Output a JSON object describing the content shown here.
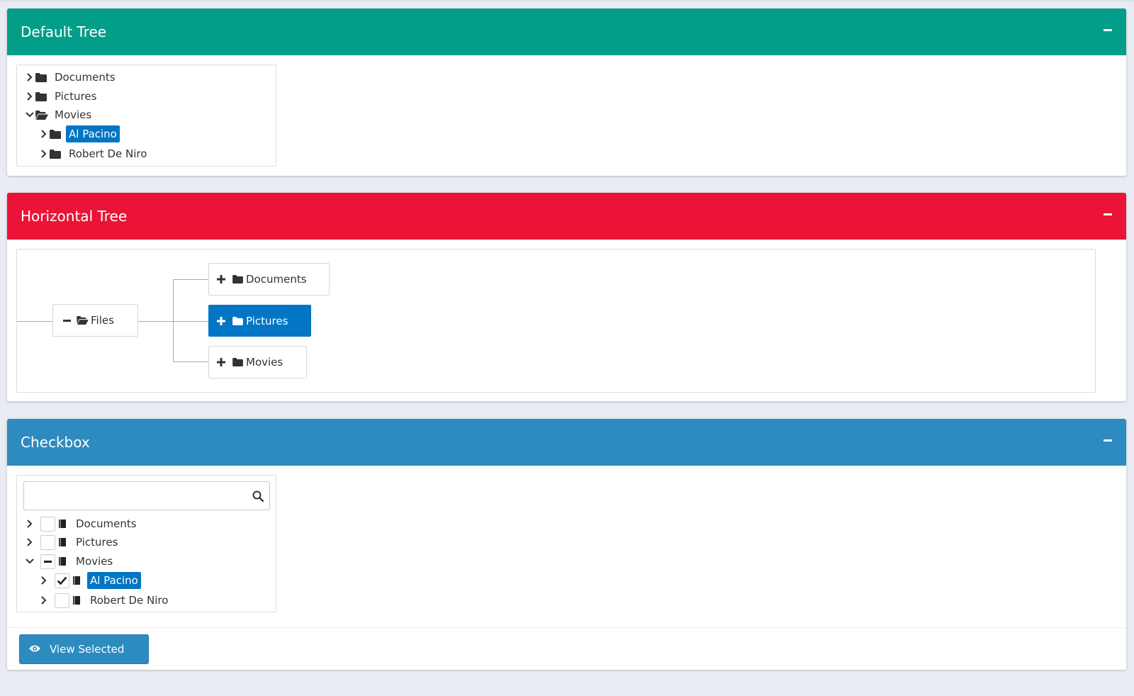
{
  "panels": {
    "default_tree": {
      "title": "Default Tree",
      "items": [
        {
          "label": "Documents",
          "state": "collapsed",
          "level": 0
        },
        {
          "label": "Pictures",
          "state": "collapsed",
          "level": 0
        },
        {
          "label": "Movies",
          "state": "expanded",
          "level": 0
        },
        {
          "label": "Al Pacino",
          "state": "collapsed",
          "level": 1,
          "selected": true
        },
        {
          "label": "Robert De Niro",
          "state": "collapsed",
          "level": 1
        }
      ]
    },
    "horizontal_tree": {
      "title": "Horizontal Tree",
      "root": {
        "label": "Files",
        "toggle": "minus"
      },
      "children": [
        {
          "label": "Documents",
          "toggle": "plus"
        },
        {
          "label": "Pictures",
          "toggle": "plus",
          "selected": true
        },
        {
          "label": "Movies",
          "toggle": "plus"
        }
      ]
    },
    "checkbox": {
      "title": "Checkbox",
      "search": {
        "value": "",
        "placeholder": ""
      },
      "items": [
        {
          "label": "Documents",
          "state": "collapsed",
          "check": "unchecked",
          "level": 0
        },
        {
          "label": "Pictures",
          "state": "collapsed",
          "check": "unchecked",
          "level": 0
        },
        {
          "label": "Movies",
          "state": "expanded",
          "check": "partial",
          "level": 0
        },
        {
          "label": "Al Pacino",
          "state": "collapsed",
          "check": "checked",
          "level": 1,
          "selected": true
        },
        {
          "label": "Robert De Niro",
          "state": "collapsed",
          "check": "unchecked",
          "level": 1
        }
      ],
      "button_label": "View Selected"
    }
  },
  "colors": {
    "green_header": "#029e89",
    "red_header": "#eb1436",
    "blue_header": "#2d8bc0",
    "selected": "#0275c4",
    "background": "#e9ecf3"
  },
  "icons": {
    "collapse": "minus-icon",
    "chevron_right": "chevron-right-icon",
    "chevron_down": "chevron-down-icon",
    "folder": "folder-icon",
    "folder_open": "folder-open-icon",
    "book": "book-icon",
    "search": "search-icon",
    "eye": "eye-icon",
    "check": "check-icon",
    "plus": "plus-icon"
  }
}
